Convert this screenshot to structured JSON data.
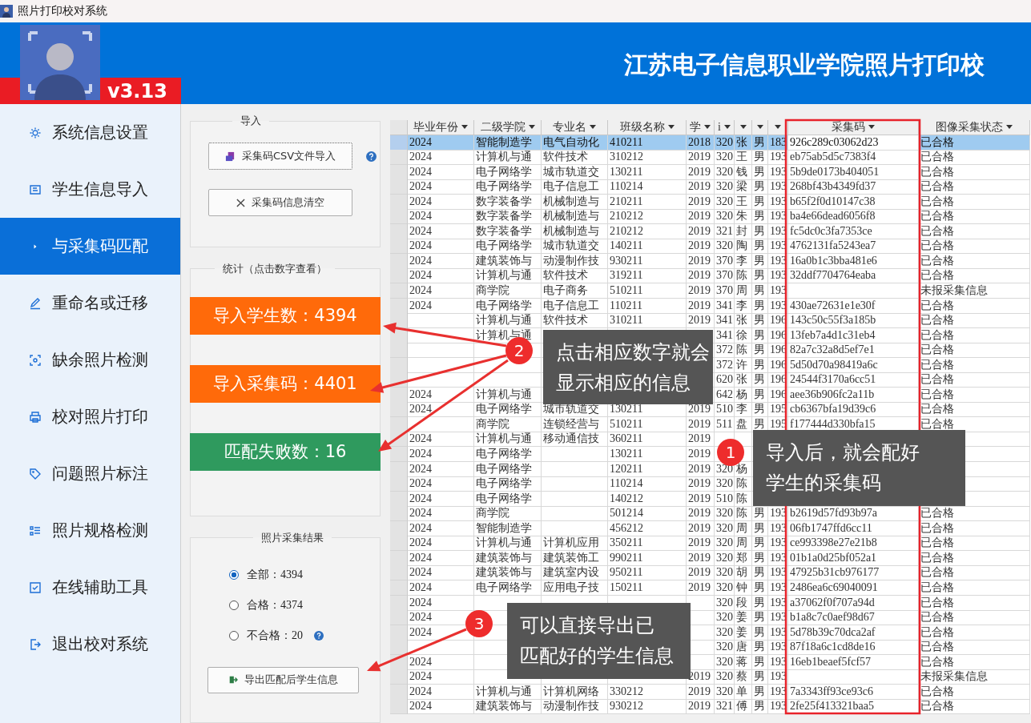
{
  "window": {
    "title": "照片打印校对系统"
  },
  "header": {
    "version": "v3.13",
    "title": "江苏电子信息职业学院照片打印校"
  },
  "sidebar": {
    "items": [
      {
        "label": "系统信息设置",
        "selected": false
      },
      {
        "label": "学生信息导入",
        "selected": false
      },
      {
        "label": "与采集码匹配",
        "selected": true
      },
      {
        "label": "重命名或迁移",
        "selected": false
      },
      {
        "label": "缺余照片检测",
        "selected": false
      },
      {
        "label": "校对照片打印",
        "selected": false
      },
      {
        "label": "问题照片标注",
        "selected": false
      },
      {
        "label": "照片规格检测",
        "selected": false
      },
      {
        "label": "在线辅助工具",
        "selected": false
      },
      {
        "label": "退出校对系统",
        "selected": false
      }
    ]
  },
  "import_group": {
    "title": "导入",
    "import_button": "采集码CSV文件导入",
    "clear_button": "采集码信息清空"
  },
  "stats_group": {
    "title": "统计（点击数字查看）",
    "stats": [
      {
        "label": "导入学生数：4394",
        "color": "#ff6a0a"
      },
      {
        "label": "导入采集码：4401",
        "color": "#ff6a0a"
      },
      {
        "label": "匹配失败数：16",
        "color": "#2f9a5e"
      }
    ]
  },
  "result_group": {
    "title": "照片采集结果",
    "options": [
      {
        "label": "全部：4394",
        "selected": true
      },
      {
        "label": "合格：4374",
        "selected": false
      },
      {
        "label": "不合格：20",
        "selected": false
      }
    ],
    "export_button": "导出匹配后学生信息"
  },
  "table": {
    "columns": [
      "毕业年份",
      "二级学院",
      "专业名",
      "班级名称",
      "学",
      "i",
      null,
      null,
      null,
      "采集码",
      "图像采集状态"
    ],
    "rows": [
      {
        "selected": true,
        "cells": [
          "2024",
          "智能制造学",
          "电气自动化",
          "410211",
          "2018",
          "320",
          "张",
          "男",
          "183",
          "926c289c03062d23",
          "已合格"
        ]
      },
      {
        "selected": false,
        "cells": [
          "2024",
          "计算机与通",
          "软件技术",
          "310212",
          "2019",
          "320",
          "王",
          "男",
          "193",
          "eb75ab5d5c7383f4",
          "已合格"
        ]
      },
      {
        "selected": false,
        "cells": [
          "2024",
          "电子网络学",
          "城市轨道交",
          "130211",
          "2019",
          "320",
          "钱",
          "男",
          "193",
          "5b9de0173b404051",
          "已合格"
        ]
      },
      {
        "selected": false,
        "cells": [
          "2024",
          "电子网络学",
          "电子信息工",
          "110214",
          "2019",
          "320",
          "梁",
          "男",
          "193",
          "268bf43b4349fd37",
          "已合格"
        ]
      },
      {
        "selected": false,
        "cells": [
          "2024",
          "数字装备学",
          "机械制造与",
          "210211",
          "2019",
          "320",
          "王",
          "男",
          "193",
          "b65f2f0d10147c38",
          "已合格"
        ]
      },
      {
        "selected": false,
        "cells": [
          "2024",
          "数字装备学",
          "机械制造与",
          "210212",
          "2019",
          "320",
          "朱",
          "男",
          "193",
          "ba4e66dead6056f8",
          "已合格"
        ]
      },
      {
        "selected": false,
        "cells": [
          "2024",
          "数字装备学",
          "机械制造与",
          "210212",
          "2019",
          "321",
          "封",
          "男",
          "193",
          "fc5dc0c3fa7353ce",
          "已合格"
        ]
      },
      {
        "selected": false,
        "cells": [
          "2024",
          "电子网络学",
          "城市轨道交",
          "140211",
          "2019",
          "320",
          "陶",
          "男",
          "193",
          "4762131fa5243ea7",
          "已合格"
        ]
      },
      {
        "selected": false,
        "cells": [
          "2024",
          "建筑装饰与",
          "动漫制作技",
          "930211",
          "2019",
          "370",
          "李",
          "男",
          "193",
          "16a0b1c3bba481e6",
          "已合格"
        ]
      },
      {
        "selected": false,
        "cells": [
          "2024",
          "计算机与通",
          "软件技术",
          "319211",
          "2019",
          "370",
          "陈",
          "男",
          "193",
          "32ddf7704764eaba",
          "已合格"
        ]
      },
      {
        "selected": false,
        "cells": [
          "2024",
          "商学院",
          "电子商务",
          "510211",
          "2019",
          "370",
          "周",
          "男",
          "193",
          null,
          "未报采集信息"
        ]
      },
      {
        "selected": false,
        "cells": [
          "2024",
          "电子网络学",
          "电子信息工",
          "110211",
          "2019",
          "341",
          "李",
          "男",
          "193",
          "430ae72631e1e30f",
          "已合格"
        ]
      },
      {
        "selected": false,
        "cells": [
          null,
          "计算机与通",
          "软件技术",
          "310211",
          "2019",
          "341",
          "张",
          "男",
          "196",
          "143c50c55f3a185b",
          "已合格"
        ]
      },
      {
        "selected": false,
        "cells": [
          null,
          "计算机与通",
          null,
          null,
          null,
          "341",
          "徐",
          "男",
          "196",
          "13feb7a4d1c31eb4",
          "已合格"
        ]
      },
      {
        "selected": false,
        "cells": [
          null,
          null,
          null,
          null,
          null,
          "372",
          "陈",
          "男",
          "196",
          "82a7c32a8d5ef7e1",
          "已合格"
        ]
      },
      {
        "selected": false,
        "cells": [
          null,
          null,
          null,
          null,
          null,
          "372",
          "许",
          "男",
          "196",
          "5d50d70a98419a6c",
          "已合格"
        ]
      },
      {
        "selected": false,
        "cells": [
          null,
          null,
          null,
          null,
          null,
          "620",
          "张",
          "男",
          "196",
          "24544f3170a6cc51",
          "已合格"
        ]
      },
      {
        "selected": false,
        "cells": [
          "2024",
          "计算机与通",
          null,
          null,
          null,
          "642",
          "杨",
          "男",
          "196",
          "aee36b906fc2a11b",
          "已合格"
        ]
      },
      {
        "selected": false,
        "cells": [
          "2024",
          "电子网络学",
          "城市轨道交",
          "130211",
          "2019",
          "510",
          "李",
          "男",
          "195",
          "cb6367bfa19d39c6",
          "已合格"
        ]
      },
      {
        "selected": false,
        "cells": [
          null,
          "商学院",
          "连锁经营与",
          "510211",
          "2019",
          "511",
          "盘",
          "男",
          "195",
          "f177444d330bfa15",
          "已合格"
        ]
      },
      {
        "selected": false,
        "cells": [
          "2024",
          "计算机与通",
          "移动通信技",
          "360211",
          "2019",
          null,
          null,
          null,
          null,
          null,
          null
        ]
      },
      {
        "selected": false,
        "cells": [
          "2024",
          "电子网络学",
          null,
          "130211",
          "2019",
          null,
          null,
          null,
          null,
          null,
          null
        ]
      },
      {
        "selected": false,
        "cells": [
          "2024",
          "电子网络学",
          null,
          "120211",
          "2019",
          "320",
          "杨",
          null,
          null,
          null,
          null
        ]
      },
      {
        "selected": false,
        "cells": [
          "2024",
          "电子网络学",
          null,
          "110214",
          "2019",
          "320",
          "陈",
          null,
          null,
          null,
          null
        ]
      },
      {
        "selected": false,
        "cells": [
          "2024",
          "电子网络学",
          null,
          "140212",
          "2019",
          "510",
          "陈",
          null,
          null,
          null,
          null
        ]
      },
      {
        "selected": false,
        "cells": [
          "2024",
          "商学院",
          null,
          "501214",
          "2019",
          "320",
          "陈",
          "男",
          "193",
          "b2619d57fd93b97a",
          "已合格"
        ]
      },
      {
        "selected": false,
        "cells": [
          "2024",
          "智能制造学",
          null,
          "456212",
          "2019",
          "320",
          "周",
          "男",
          "193",
          "06fb1747ffd6cc11",
          "已合格"
        ]
      },
      {
        "selected": false,
        "cells": [
          "2024",
          "计算机与通",
          "计算机应用",
          "350211",
          "2019",
          "320",
          "周",
          "男",
          "193",
          "ce993398e27e21b8",
          "已合格"
        ]
      },
      {
        "selected": false,
        "cells": [
          "2024",
          "建筑装饰与",
          "建筑装饰工",
          "990211",
          "2019",
          "320",
          "郑",
          "男",
          "193",
          "01b1a0d25bf052a1",
          "已合格"
        ]
      },
      {
        "selected": false,
        "cells": [
          "2024",
          "建筑装饰与",
          "建筑室内设",
          "950211",
          "2019",
          "320",
          "胡",
          "男",
          "193",
          "47925b31cb976177",
          "已合格"
        ]
      },
      {
        "selected": false,
        "cells": [
          "2024",
          "电子网络学",
          "应用电子技",
          "150211",
          "2019",
          "320",
          "钟",
          "男",
          "193",
          "2486ea6c69040091",
          "已合格"
        ]
      },
      {
        "selected": false,
        "cells": [
          "2024",
          null,
          null,
          null,
          null,
          "320",
          "段",
          "男",
          "193",
          "a37062f0f707a94d",
          "已合格"
        ]
      },
      {
        "selected": false,
        "cells": [
          "2024",
          null,
          null,
          null,
          null,
          "320",
          "姜",
          "男",
          "193",
          "b1a8c7c0aef98d67",
          "已合格"
        ]
      },
      {
        "selected": false,
        "cells": [
          "2024",
          null,
          null,
          null,
          null,
          "320",
          "姜",
          "男",
          "193",
          "5d78b39c70dca2af",
          "已合格"
        ]
      },
      {
        "selected": false,
        "cells": [
          null,
          null,
          null,
          null,
          null,
          "320",
          "唐",
          "男",
          "193",
          "87f18a6c1cd8de16",
          "已合格"
        ]
      },
      {
        "selected": false,
        "cells": [
          "2024",
          null,
          null,
          null,
          null,
          "320",
          "蒋",
          "男",
          "193",
          "16eb1beaef5fcf57",
          "已合格"
        ]
      },
      {
        "selected": false,
        "cells": [
          "2024",
          null,
          null,
          null,
          "2019",
          "320",
          "蔡",
          "男",
          "193",
          null,
          "未报采集信息"
        ]
      },
      {
        "selected": false,
        "cells": [
          "2024",
          "计算机与通",
          "计算机网络",
          "330212",
          "2019",
          "320",
          "单",
          "男",
          "193",
          "7a3343ff93ce93c6",
          "已合格"
        ]
      },
      {
        "selected": false,
        "cells": [
          "2024",
          "建筑装饰与",
          "动漫制作技",
          "930212",
          "2019",
          "321",
          "傅",
          "男",
          "193",
          "2fe25f413321baa5",
          "已合格"
        ]
      }
    ]
  },
  "callouts": [
    {
      "number": "2",
      "lines": [
        "点击相应数字就会",
        "显示相应的信息"
      ]
    },
    {
      "number": "1",
      "lines": [
        "导入后，就会配好",
        "学生的采集码"
      ]
    },
    {
      "number": "3",
      "lines": [
        "可以直接导出已",
        "匹配好的学生信息"
      ]
    }
  ]
}
